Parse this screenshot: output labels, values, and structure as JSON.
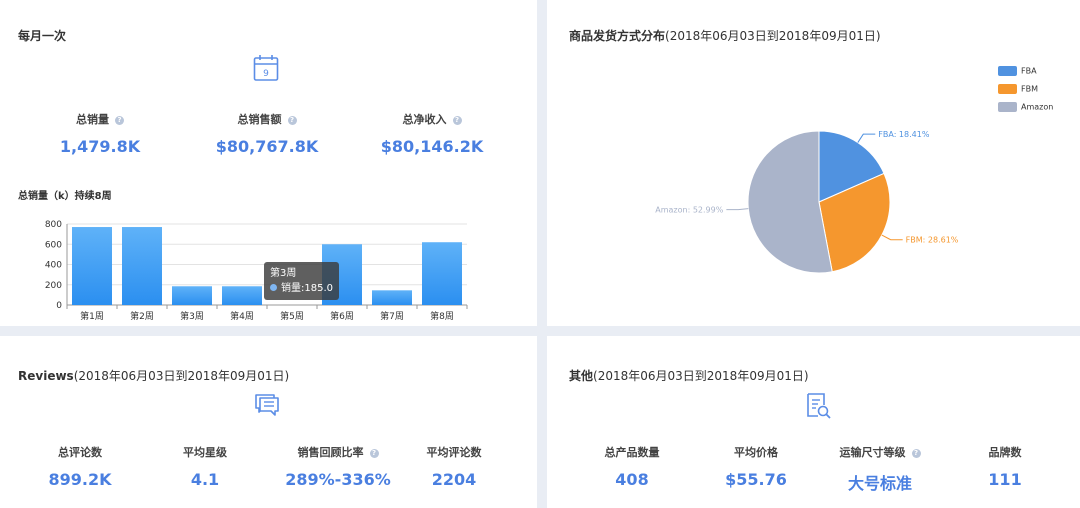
{
  "monthly": {
    "title": "每月一次",
    "calendar_day": "9",
    "metrics": [
      {
        "label": "总销量",
        "value": "1,479.8K"
      },
      {
        "label": "总销售额",
        "value": "$80,767.8K"
      },
      {
        "label": "总净收入",
        "value": "$80,146.2K"
      }
    ],
    "chart_title": "总销量（k）持续8周",
    "tooltip": {
      "title": "第3周",
      "series": "销量",
      "value": "185.0"
    }
  },
  "chart_data": [
    {
      "type": "bar",
      "categories": [
        "第1周",
        "第2周",
        "第3周",
        "第4周",
        "第5周",
        "第6周",
        "第7周",
        "第8周"
      ],
      "values": [
        770,
        770,
        185,
        185,
        0,
        600,
        145,
        620
      ],
      "ylim": [
        0,
        800
      ],
      "yticks": [
        "0",
        "200",
        "400",
        "600",
        "800"
      ],
      "color": "#2b8ff0",
      "grid": true
    },
    {
      "type": "pie",
      "title": "商品发货方式分布",
      "labels": [
        "FBA",
        "FBM",
        "Amazon"
      ],
      "values": [
        18.41,
        28.61,
        52.99
      ],
      "slice_labels": [
        "FBA: 18.41%",
        "FBM: 28.61%",
        "Amazon: 52.99%"
      ],
      "colors": [
        "#5092e0",
        "#f5972e",
        "#aab4ca"
      ],
      "legend": "top-right"
    }
  ],
  "pie_panel": {
    "title": "商品发货方式分布",
    "subtitle": "(2018年06月03日到2018年09月01日)"
  },
  "reviews": {
    "title": "Reviews",
    "subtitle": "(2018年06月03日到2018年09月01日)",
    "metrics": [
      {
        "label": "总评论数",
        "value": "899.2K"
      },
      {
        "label": "平均星级",
        "value": "4.1"
      },
      {
        "label": "销售回顾比率",
        "value": "289%-336%"
      },
      {
        "label": "平均评论数",
        "value": "2204"
      }
    ]
  },
  "others": {
    "title": "其他",
    "subtitle": "(2018年06月03日到2018年09月01日)",
    "metrics": [
      {
        "label": "总产品数量",
        "value": "408"
      },
      {
        "label": "平均价格",
        "value": "$55.76"
      },
      {
        "label": "运输尺寸等级",
        "value": "大号标准"
      },
      {
        "label": "品牌数",
        "value": "111"
      }
    ]
  },
  "icons": {
    "calendar": "calendar-icon",
    "chat": "chat-icon",
    "document_search": "document-search-icon",
    "help": "help-icon"
  },
  "colors": {
    "accent": "#4a7fe0",
    "icon": "#5b8de6",
    "bar": "#2b8ff0",
    "background": "#e9edf4"
  }
}
